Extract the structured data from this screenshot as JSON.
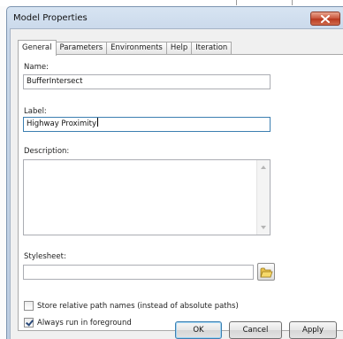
{
  "window": {
    "title": "Model Properties"
  },
  "tabs": [
    {
      "label": "General",
      "active": true
    },
    {
      "label": "Parameters",
      "active": false
    },
    {
      "label": "Environments",
      "active": false
    },
    {
      "label": "Help",
      "active": false
    },
    {
      "label": "Iteration",
      "active": false
    }
  ],
  "general": {
    "name_label": "Name:",
    "name_value": "BufferIntersect",
    "label_label": "Label:",
    "label_value": "Highway Proximity",
    "description_label": "Description:",
    "description_value": "",
    "stylesheet_label": "Stylesheet:",
    "stylesheet_value": ""
  },
  "options": [
    {
      "label": "Store relative path names (instead of absolute paths)",
      "checked": false
    },
    {
      "label": "Always run in foreground",
      "checked": true
    }
  ],
  "buttons": {
    "ok": "OK",
    "cancel": "Cancel",
    "apply": "Apply"
  },
  "icons": {
    "close": "close-icon",
    "browse": "folder-open-icon"
  },
  "colors": {
    "focus_border": "#3c7fb1",
    "close_button": "#c9533a",
    "checkmark": "#2a4a7a"
  }
}
